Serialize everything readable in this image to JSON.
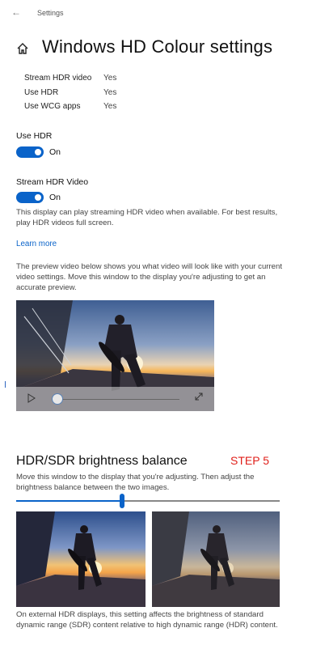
{
  "window": {
    "app_title": "Settings"
  },
  "page": {
    "title": "Windows HD Colour settings"
  },
  "display_info": [
    {
      "label": "Stream HDR video",
      "value": "Yes"
    },
    {
      "label": "Use HDR",
      "value": "Yes"
    },
    {
      "label": "Use WCG apps",
      "value": "Yes"
    }
  ],
  "use_hdr": {
    "label": "Use HDR",
    "state": "On"
  },
  "stream_hdr": {
    "label": "Stream HDR Video",
    "state": "On",
    "description": "This display can play streaming HDR video when available. For best results, play HDR videos full screen."
  },
  "learn_more": "Learn more",
  "preview_description": "The preview video below shows you what video will look like with your current video settings. Move this window to the display you're adjusting to get an accurate preview.",
  "video_player": {
    "progress": 0.0
  },
  "balance": {
    "title": "HDR/SDR brightness balance",
    "step": "STEP 5",
    "description": "Move this window to the display that you're adjusting. Then adjust the brightness balance between the two images.",
    "slider_value": 0.4,
    "footer": "On external HDR displays, this setting affects the brightness of standard dynamic range (SDR) content relative to high dynamic range (HDR) content."
  },
  "colors": {
    "accent": "#0a63c9",
    "step_red": "#e0201b"
  },
  "icons": {
    "back": "back-arrow-icon",
    "home": "home-icon",
    "play": "play-icon",
    "expand": "expand-icon"
  }
}
